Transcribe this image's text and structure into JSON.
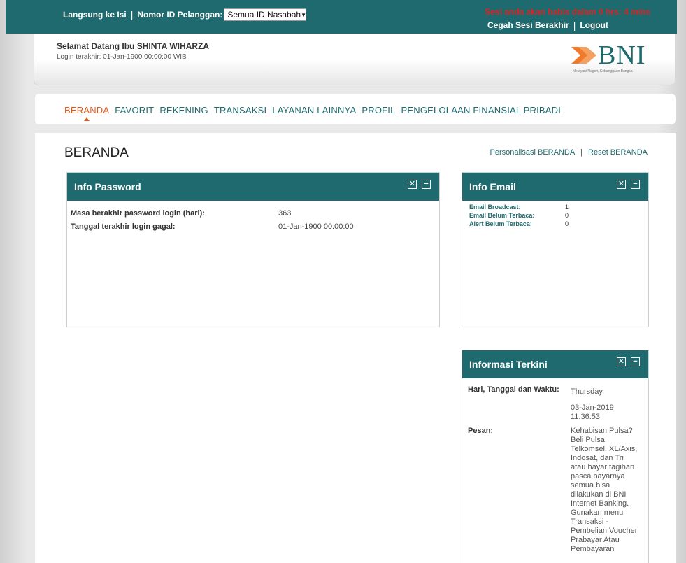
{
  "topbar": {
    "skip_link": "Langsung ke Isi",
    "customer_id_label": "Nomor ID Pelanggan:",
    "customer_id_value": "Semua ID Nasabah",
    "session_msg": "Sesi anda akan habis dalam 0 hrs: 4 mins",
    "prevent_session_end": "Cegah Sesi Berakhir",
    "logout": "Logout"
  },
  "header": {
    "welcome": "Selamat Datang Ibu  SHINTA  WIHARZA",
    "last_login": "Login terakhir:  01-Jan-1900 00:00:00  WIB",
    "logo_text": "BNI",
    "logo_tagline": "Melayani Negeri, Kebanggaan Bangsa"
  },
  "nav": {
    "items": [
      "BERANDA",
      "FAVORIT",
      "REKENING",
      "TRANSAKSI",
      "LAYANAN LAINNYA",
      "PROFIL",
      "PENGELOLAAN FINANSIAL PRIBADI"
    ],
    "active": "BERANDA"
  },
  "page": {
    "title": "BERANDA",
    "personalize": "Personalisasi BERANDA",
    "reset": "Reset BERANDA"
  },
  "panels": {
    "password": {
      "title": "Info Password",
      "rows": [
        {
          "label": "Masa berakhir password login (hari):",
          "value": "363"
        },
        {
          "label": "Tanggal terakhir login gagal:",
          "value": "01-Jan-1900 00:00:00"
        }
      ]
    },
    "email": {
      "title": "Info Email",
      "rows": [
        {
          "label": "Email Broadcast:",
          "value": "1"
        },
        {
          "label": "Email Belum Terbaca:",
          "value": "0"
        },
        {
          "label": "Alert Belum Terbaca:",
          "value": "0"
        }
      ]
    },
    "info": {
      "title": "Informasi Terkini",
      "date_label": "Hari, Tanggal dan Waktu:",
      "day": "Thursday,",
      "datetime": "03-Jan-2019 11:36:53",
      "message_label": "Pesan:",
      "message": "Kehabisan Pulsa? Beli Pulsa Telkomsel, XL/Axis, Indosat, dan Tri atau bayar tagihan pasca bayarnya semua bisa dilakukan di BNI Internet Banking. Gunakan menu Transaksi - Pembelian Voucher Prabayar Atau Pembayaran"
    }
  },
  "icons": {
    "close": "close-icon",
    "minimize": "minimize-icon"
  },
  "colors": {
    "brand_teal": "#1f6a6e",
    "accent_orange": "#e05a1a",
    "session_red": "#e02020"
  }
}
